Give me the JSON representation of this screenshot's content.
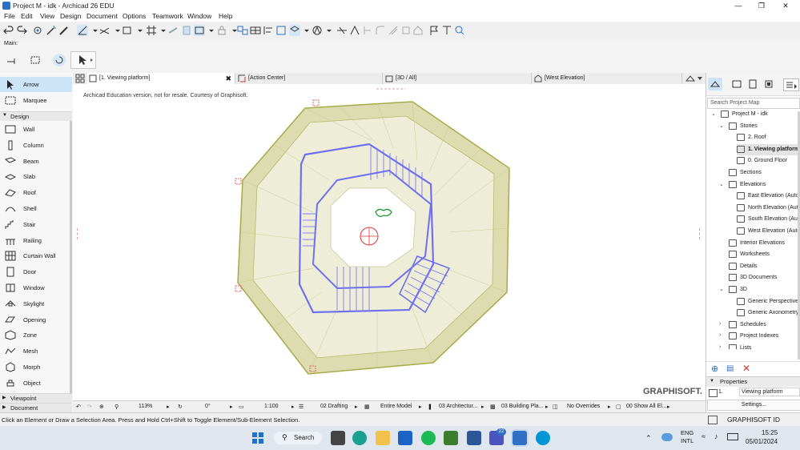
{
  "window": {
    "title": "Project M - idk - Archicad 26 EDU"
  },
  "menu": [
    "File",
    "Edit",
    "View",
    "Design",
    "Document",
    "Options",
    "Teamwork",
    "Window",
    "Help"
  ],
  "toolbar2": {
    "label": "Main:"
  },
  "toolbox": {
    "selection": [
      {
        "label": "Arrow",
        "icon": "arrow-icon"
      },
      {
        "label": "Marquee",
        "icon": "marquee-icon"
      }
    ],
    "design_label": "Design",
    "design_tools": [
      {
        "label": "Wall",
        "icon": "wall-icon"
      },
      {
        "label": "Column",
        "icon": "column-icon"
      },
      {
        "label": "Beam",
        "icon": "beam-icon"
      },
      {
        "label": "Slab",
        "icon": "slab-icon"
      },
      {
        "label": "Roof",
        "icon": "roof-icon"
      },
      {
        "label": "Shell",
        "icon": "shell-icon"
      },
      {
        "label": "Stair",
        "icon": "stair-icon"
      },
      {
        "label": "Railing",
        "icon": "railing-icon"
      },
      {
        "label": "Curtain Wall",
        "icon": "curtain-wall-icon"
      },
      {
        "label": "Door",
        "icon": "door-icon"
      },
      {
        "label": "Window",
        "icon": "window-icon"
      },
      {
        "label": "Skylight",
        "icon": "skylight-icon"
      },
      {
        "label": "Opening",
        "icon": "opening-icon"
      },
      {
        "label": "Zone",
        "icon": "zone-icon"
      },
      {
        "label": "Mesh",
        "icon": "mesh-icon"
      },
      {
        "label": "Morph",
        "icon": "morph-icon"
      },
      {
        "label": "Object",
        "icon": "object-icon"
      }
    ],
    "viewpoint_label": "Viewpoint",
    "document_label": "Document"
  },
  "tabs": [
    {
      "label": "[1. Viewing platform]",
      "active": true
    },
    {
      "label": "[Action Center]"
    },
    {
      "label": "[3D / All]"
    },
    {
      "label": "[West Elevation]"
    }
  ],
  "canvas": {
    "watermark_text": "Archicad Education version, not for resale. Courtesy of Graphisoft.",
    "brand": "GRAPHISOFT."
  },
  "bottom_bar": {
    "zoom": "113%",
    "angle": "0°",
    "scale": "1:100",
    "layer_combo": "02 Drafting",
    "model_view": "Entire Model",
    "pen_set": "03 Architectur...",
    "mvo": "03 Building Pla...",
    "override": "No Overrides",
    "dimensions": "00 Show All El..."
  },
  "navigator": {
    "search_placeholder": "Search Project Map",
    "tree": [
      {
        "label": "Project M - idk",
        "level": 0,
        "carat": "v"
      },
      {
        "label": "Stories",
        "level": 1,
        "carat": "v"
      },
      {
        "label": "2. Roof",
        "level": 2
      },
      {
        "label": "1. Viewing platform",
        "level": 2,
        "selected": true
      },
      {
        "label": "0. Ground Floor",
        "level": 2
      },
      {
        "label": "Sections",
        "level": 1
      },
      {
        "label": "Elevations",
        "level": 1,
        "carat": "v"
      },
      {
        "label": "East Elevation (Auto-r",
        "level": 2
      },
      {
        "label": "North Elevation (Auto",
        "level": 2
      },
      {
        "label": "South Elevation (Auto",
        "level": 2
      },
      {
        "label": "West Elevation (Auto-",
        "level": 2
      },
      {
        "label": "Interior Elevations",
        "level": 1
      },
      {
        "label": "Worksheets",
        "level": 1
      },
      {
        "label": "Details",
        "level": 1
      },
      {
        "label": "3D Documents",
        "level": 1
      },
      {
        "label": "3D",
        "level": 1,
        "carat": "v"
      },
      {
        "label": "Generic Perspective",
        "level": 2
      },
      {
        "label": "Generic Axonometry",
        "level": 2
      },
      {
        "label": "Schedules",
        "level": 1,
        "carat": ">"
      },
      {
        "label": "Project Indexes",
        "level": 1,
        "carat": ">"
      },
      {
        "label": "Lists",
        "level": 1,
        "carat": ">"
      }
    ],
    "properties_label": "Properties",
    "prop_num": "1.",
    "prop_value": "Viewing platform",
    "settings_label": "Settings...",
    "graphisoft_id": "GRAPHISOFT ID"
  },
  "status": {
    "text": "Click an Element or Draw a Selection Area. Press and Hold Ctrl+Shift to Toggle Element/Sub-Element Selection."
  },
  "taskbar": {
    "search_label": "Search",
    "badge": "22",
    "lang_line1": "ENG",
    "lang_line2": "INTL",
    "time": "15:25",
    "date": "05/01/2024"
  },
  "colors": {
    "accent": "#2f6fc6",
    "selected_tool": "#cce4f7",
    "stair_blue": "#6f6ff0",
    "roof_fill": "#d9dca8",
    "roof_stroke": "#a7aa4a"
  }
}
